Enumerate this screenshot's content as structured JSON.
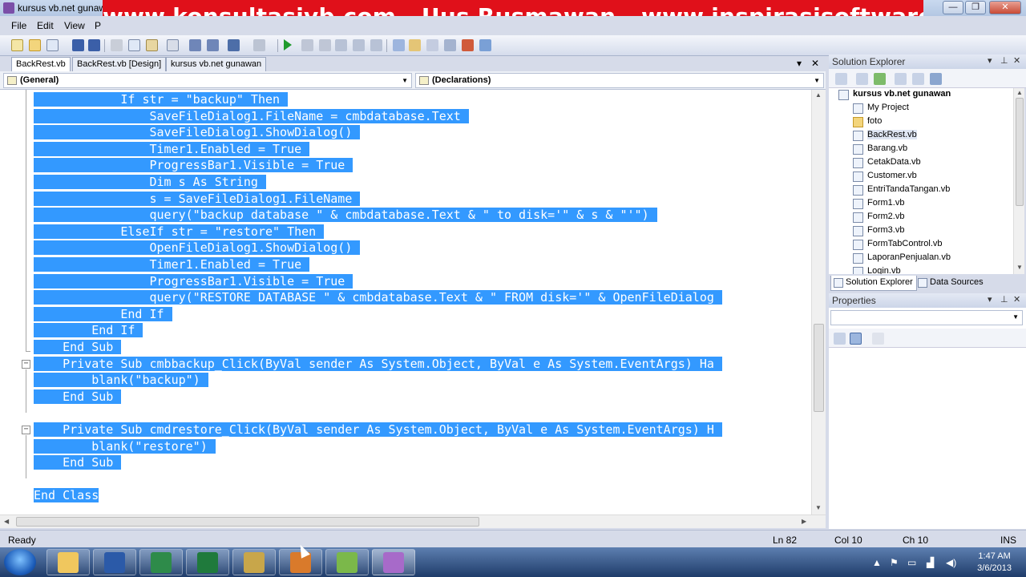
{
  "window": {
    "title": "kursus vb.net gunawan"
  },
  "banner": {
    "text": "www.konsultasivb.com - Uus Rusmawan - www.inspirasisoftware.com"
  },
  "menu": {
    "items": [
      "File",
      "Edit",
      "View",
      "P"
    ]
  },
  "doc_tabs": [
    {
      "label": "BackRest.vb",
      "active": true
    },
    {
      "label": "BackRest.vb [Design]",
      "active": false
    },
    {
      "label": "kursus vb.net gunawan",
      "active": false
    }
  ],
  "tab_controls": {
    "dropdown": "▾",
    "close": "✕"
  },
  "navbar": {
    "left_combo": "(General)",
    "right_combo": "(Declarations)"
  },
  "code_lines": [
    "            If str = \"backup\" Then",
    "                SaveFileDialog1.FileName = cmbdatabase.Text",
    "                SaveFileDialog1.ShowDialog()",
    "                Timer1.Enabled = True",
    "                ProgressBar1.Visible = True",
    "                Dim s As String",
    "                s = SaveFileDialog1.FileName",
    "                query(\"backup database \" & cmbdatabase.Text & \" to disk='\" & s & \"'\")",
    "            ElseIf str = \"restore\" Then",
    "                OpenFileDialog1.ShowDialog()",
    "                Timer1.Enabled = True",
    "                ProgressBar1.Visible = True",
    "                query(\"RESTORE DATABASE \" & cmbdatabase.Text & \" FROM disk='\" & OpenFileDialog",
    "            End If",
    "        End If",
    "    End Sub",
    "    Private Sub cmbbackup_Click(ByVal sender As System.Object, ByVal e As System.EventArgs) Ha",
    "        blank(\"backup\")",
    "    End Sub",
    "",
    "    Private Sub cmdrestore_Click(ByVal sender As System.Object, ByVal e As System.EventArgs) H",
    "        blank(\"restore\")",
    "    End Sub",
    "",
    "End Class"
  ],
  "solution_explorer": {
    "title": "Solution Explorer",
    "root": "kursus vb.net gunawan",
    "items": [
      {
        "label": "My Project",
        "icon": "my-project-icon"
      },
      {
        "label": "foto",
        "icon": "folder-icon"
      },
      {
        "label": "BackRest.vb",
        "icon": "vb-file-icon",
        "selected": true
      },
      {
        "label": "Barang.vb",
        "icon": "vb-file-icon"
      },
      {
        "label": "CetakData.vb",
        "icon": "vb-file-icon"
      },
      {
        "label": "Customer.vb",
        "icon": "vb-file-icon"
      },
      {
        "label": "EntriTandaTangan.vb",
        "icon": "vb-file-icon"
      },
      {
        "label": "Form1.vb",
        "icon": "vb-file-icon"
      },
      {
        "label": "Form2.vb",
        "icon": "vb-file-icon"
      },
      {
        "label": "Form3.vb",
        "icon": "vb-file-icon"
      },
      {
        "label": "FormTabControl.vb",
        "icon": "vb-file-icon"
      },
      {
        "label": "LaporanPenjualan.vb",
        "icon": "vb-file-icon"
      },
      {
        "label": "Login.vb",
        "icon": "vb-file-icon"
      }
    ],
    "tabs": [
      "Solution Explorer",
      "Data Sources"
    ]
  },
  "properties": {
    "title": "Properties"
  },
  "panel_controls": {
    "dropdown": "▾",
    "pin": "⊥",
    "close": "✕"
  },
  "status": {
    "ready": "Ready",
    "ln": "Ln 82",
    "col": "Col 10",
    "ch": "Ch 10",
    "mode": "INS"
  },
  "clock": {
    "time": "1:47 AM",
    "date": "3/6/2013"
  },
  "colors": {
    "selection": "#3399ff",
    "banner": "#e0101a",
    "chrome": "#d6dbe9"
  }
}
